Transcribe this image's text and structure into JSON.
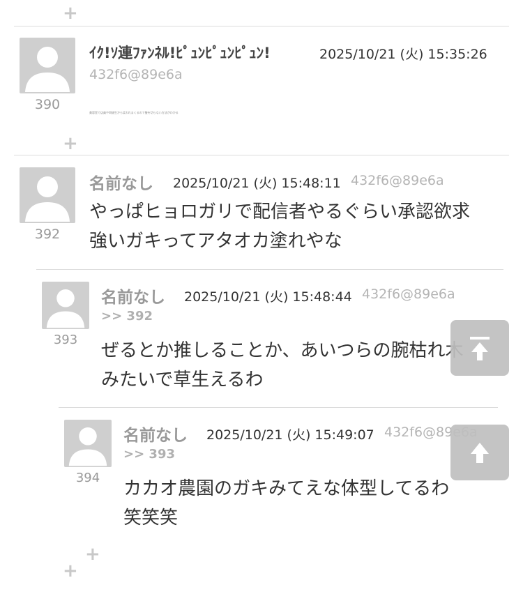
{
  "posts": [
    {
      "number": "390",
      "name": "ｲｸ!ｿ連ﾌｧﾝﾈﾙ!ﾋﾟｭﾝﾋﾟｭﾝﾋﾟｭﾝ!",
      "date": "2025/10/21 (火) 15:35:26",
      "id": "432f6@89e6a",
      "body_small": "美容室で店員や同級生から笑われまくるので髪を切らない方法がわかる"
    },
    {
      "number": "392",
      "name": "名前なし",
      "date": "2025/10/21 (火) 15:48:11",
      "id": "432f6@89e6a",
      "body_lines": [
        "やっぱヒョロガリで配信者やるぐらい承認欲求",
        "強いガキってアタオカ塗れやな"
      ]
    },
    {
      "number": "393",
      "name": "名前なし",
      "date": "2025/10/21 (火) 15:48:44",
      "id": "432f6@89e6a",
      "reply_to": ">> 392",
      "body_lines": [
        "ぜるとか推しることか、あいつらの腕枯れ木",
        "みたいで草生えるわ"
      ]
    },
    {
      "number": "394",
      "name": "名前なし",
      "date": "2025/10/21 (火) 15:49:07",
      "id": "432f6@89e6a",
      "reply_to": ">> 393",
      "body_lines": [
        "カカオ農園のガキみてえな体型してるわ",
        "笑笑笑"
      ]
    }
  ],
  "icons": {
    "expand": "plus-icon",
    "avatar": "default-user-icon",
    "scroll_top": "scroll-to-top-icon",
    "scroll_up": "arrow-up-icon"
  },
  "colors": {
    "meta_gray": "#999999",
    "fab_gray": "#bfbfbf",
    "divider": "#dcdcdc"
  }
}
